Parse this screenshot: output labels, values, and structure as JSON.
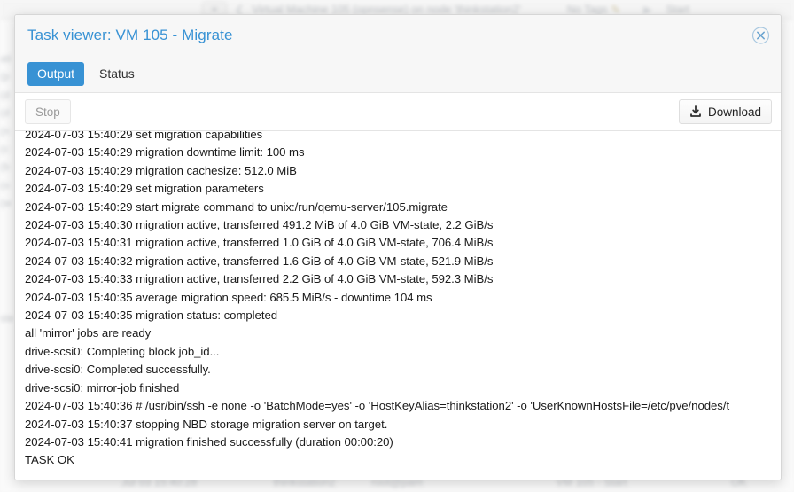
{
  "backdrop": {
    "topbar": {
      "breadcrumb": "Virtual Machine 105 (opnsense) on node 'thinkstation2'",
      "tags": "No Tags",
      "pencil_icon": "pencil-icon",
      "start": "Start"
    },
    "left_fragments": [
      "ati",
      "(p",
      "(d",
      "(d",
      "(n",
      "(c",
      "(b",
      "(o",
      "(w"
    ],
    "side_fragment": "ste",
    "bottom_row": {
      "time": "Jul 03 15:40:28",
      "node": "thinkstation2",
      "user": "root@pam",
      "description": "VM 105 - Start",
      "status": "OK"
    }
  },
  "dialog": {
    "title": "Task viewer: VM 105 - Migrate",
    "close_icon": "close-circle-icon",
    "tabs": [
      {
        "label": "Output",
        "active": true
      },
      {
        "label": "Status",
        "active": false
      }
    ],
    "toolbar": {
      "stop_label": "Stop",
      "stop_disabled": true,
      "download_label": "Download",
      "download_icon": "download-icon"
    },
    "log_lines": [
      "2024-07-03 15:40:29 set migration capabilities",
      "2024-07-03 15:40:29 migration downtime limit: 100 ms",
      "2024-07-03 15:40:29 migration cachesize: 512.0 MiB",
      "2024-07-03 15:40:29 set migration parameters",
      "2024-07-03 15:40:29 start migrate command to unix:/run/qemu-server/105.migrate",
      "2024-07-03 15:40:30 migration active, transferred 491.2 MiB of 4.0 GiB VM-state, 2.2 GiB/s",
      "2024-07-03 15:40:31 migration active, transferred 1.0 GiB of 4.0 GiB VM-state, 706.4 MiB/s",
      "2024-07-03 15:40:32 migration active, transferred 1.6 GiB of 4.0 GiB VM-state, 521.9 MiB/s",
      "2024-07-03 15:40:33 migration active, transferred 2.2 GiB of 4.0 GiB VM-state, 592.3 MiB/s",
      "2024-07-03 15:40:35 average migration speed: 685.5 MiB/s - downtime 104 ms",
      "2024-07-03 15:40:35 migration status: completed",
      "all 'mirror' jobs are ready",
      "drive-scsi0: Completing block job_id...",
      "drive-scsi0: Completed successfully.",
      "drive-scsi0: mirror-job finished",
      "2024-07-03 15:40:36 # /usr/bin/ssh -e none -o 'BatchMode=yes' -o 'HostKeyAlias=thinkstation2' -o 'UserKnownHostsFile=/etc/pve/nodes/t",
      "2024-07-03 15:40:37 stopping NBD storage migration server on target.",
      "2024-07-03 15:40:41 migration finished successfully (duration 00:00:20)",
      "TASK OK"
    ]
  },
  "colors": {
    "accent": "#3892d4",
    "title": "#3892d4",
    "log_text": "#1b1b1b",
    "header_bg": "#f7f7f7"
  }
}
